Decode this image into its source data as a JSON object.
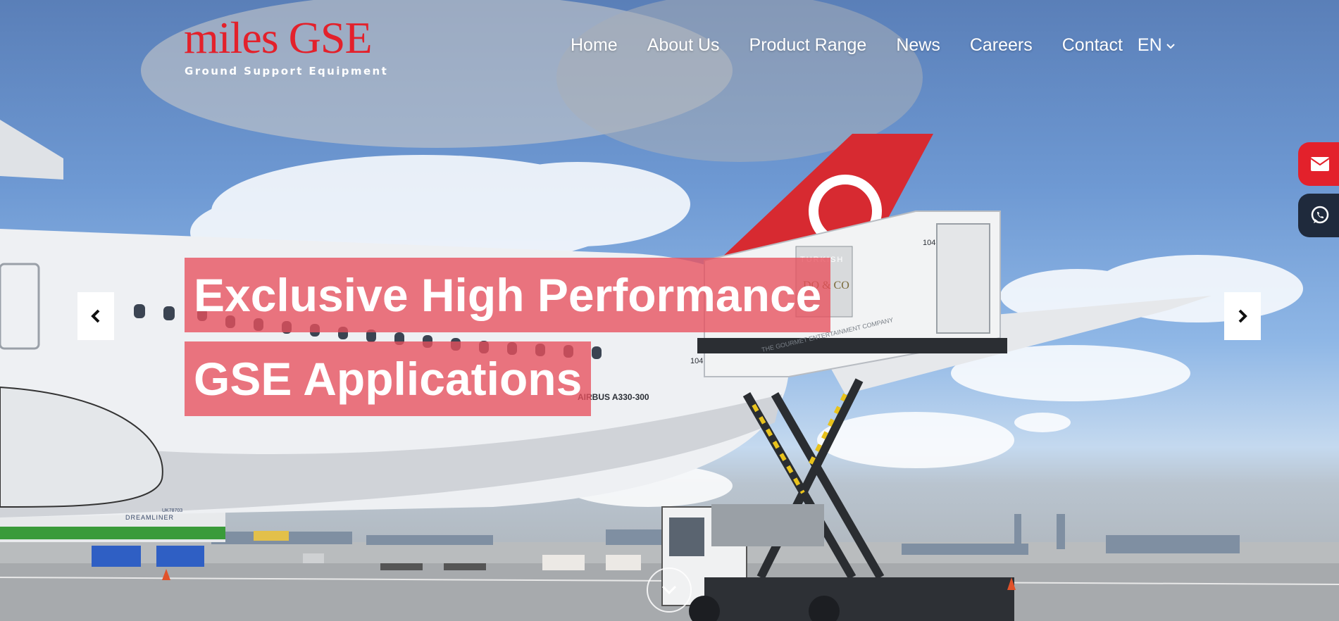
{
  "brand": {
    "name": "miles GSE",
    "tagline": "Ground Support Equipment",
    "accent_color": "#e3212b"
  },
  "nav": {
    "items": [
      {
        "label": "Home"
      },
      {
        "label": "About Us"
      },
      {
        "label": "Product Range"
      },
      {
        "label": "News"
      },
      {
        "label": "Careers"
      },
      {
        "label": "Contact"
      }
    ],
    "language": "EN",
    "language_icon": "chevron-down-icon"
  },
  "hero": {
    "headline_line1": "Exclusive High Performance",
    "headline_line2": "GSE Applications",
    "headline_bg_color": "#e8505c",
    "prev_icon": "chevron-left-icon",
    "next_icon": "chevron-right-icon",
    "scroll_icon": "chevron-down-icon"
  },
  "side_buttons": [
    {
      "icon": "envelope-icon",
      "color": "#e3212b"
    },
    {
      "icon": "whatsapp-icon",
      "color": "#1f2a3c"
    }
  ],
  "scene_labels": {
    "aircraft_model": "AIRBUS A330-300",
    "door_number": "104",
    "truck_number": "104",
    "truck_brand_1": "TURKISH",
    "truck_brand_2": "DO & CO",
    "truck_slogan": "THE GOURMET ENTERTAINMENT COMPANY",
    "other_aircraft": "DREAMLINER",
    "other_aircraft_reg": "UK78703"
  }
}
